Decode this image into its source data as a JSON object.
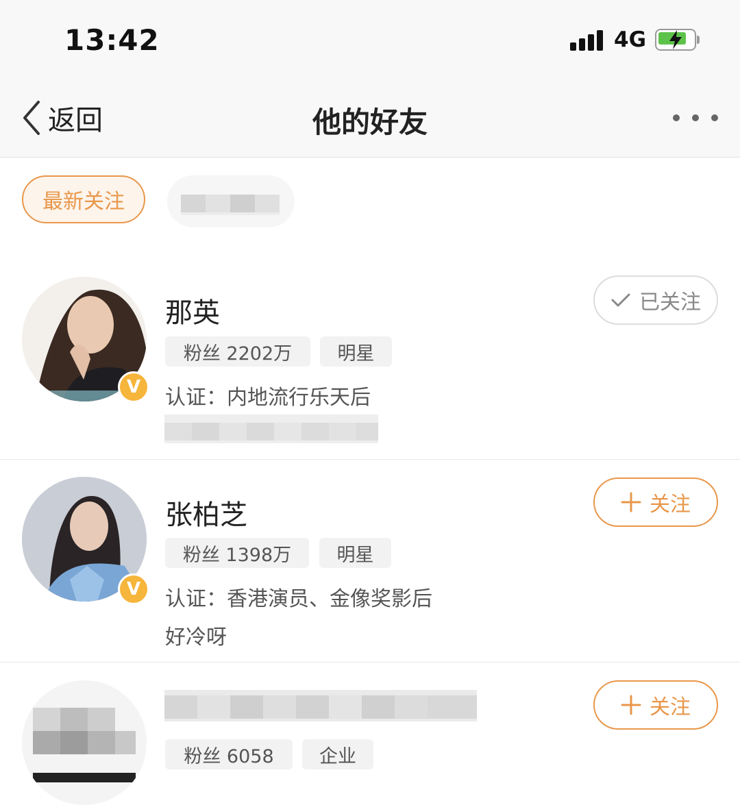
{
  "status_bar": {
    "time": "13:42",
    "network": "4G"
  },
  "nav": {
    "back_label": "返回",
    "title": "他的好友"
  },
  "filters": {
    "active_label": "最新关注"
  },
  "users": [
    {
      "name": "那英",
      "fans": "粉丝 2202万",
      "category": "明星",
      "cert": "认证：内地流行乐天后",
      "bio": "",
      "button": "已关注",
      "followed": true
    },
    {
      "name": "张柏芝",
      "fans": "粉丝 1398万",
      "category": "明星",
      "cert": "认证：香港演员、金像奖影后",
      "bio": "好冷呀",
      "button": "关注",
      "followed": false
    },
    {
      "name": "",
      "fans": "粉丝 6058",
      "category": "企业",
      "cert": "",
      "bio": "",
      "button": "关注",
      "followed": false
    }
  ],
  "colors": {
    "accent": "#e8974a",
    "verified_badge": "#f6b53b",
    "battery": "#5dc24a"
  },
  "icons": [
    "signal-icon",
    "battery-charging-icon",
    "back-chevron-icon",
    "more-icon",
    "check-icon",
    "plus-icon",
    "verified-v-icon"
  ]
}
